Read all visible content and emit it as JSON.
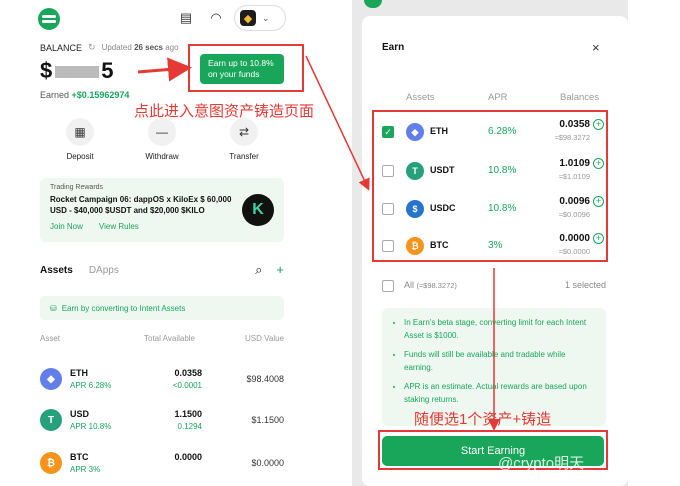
{
  "wallet": {
    "balance_label": "BALANCE",
    "updated_prefix": "Updated",
    "updated_value": "26 secs",
    "updated_suffix": "ago",
    "amount_prefix": "$",
    "amount_suffix": "5",
    "earned_label": "Earned",
    "earned_value": "+$0.15962974",
    "earn_button_line1": "Earn up to 10.8%",
    "earn_button_line2": "on your funds",
    "actions": [
      {
        "label": "Deposit",
        "icon": "qr-icon"
      },
      {
        "label": "Withdraw",
        "icon": "minus-icon"
      },
      {
        "label": "Transfer",
        "icon": "transfer-icon"
      }
    ],
    "promo": {
      "tag": "Trading Rewards",
      "title": "Rocket Campaign 06: dappOS x KiloEx $ 60,000 USD - $40,000 $USDT and $20,000 $KILO",
      "join": "Join Now",
      "rules": "View Rules",
      "logo_letter": "K"
    },
    "tabs": {
      "assets": "Assets",
      "dapps": "DApps"
    },
    "convert_text": "Earn by converting to Intent Assets",
    "columns": {
      "asset": "Asset",
      "total": "Total Available",
      "usd": "USD Value"
    },
    "assets": [
      {
        "name": "ETH",
        "apr": "APR 6.28%",
        "amount": "0.0358",
        "sub": "<0.0001",
        "usd": "$98.4008",
        "color": "#627eea",
        "glyph": "◆"
      },
      {
        "name": "USD",
        "apr": "APR 10.8%",
        "amount": "1.1500",
        "sub": "0.1294",
        "usd": "$1.1500",
        "color": "#26a17b",
        "glyph": "T"
      },
      {
        "name": "BTC",
        "apr": "APR 3%",
        "amount": "0.0000",
        "sub": "",
        "usd": "$0.0000",
        "color": "#f7931a",
        "glyph": "₿"
      }
    ]
  },
  "annotations": {
    "left": "点此进入意图资产铸造页面",
    "right": "随便选1个资产+铸造",
    "watermark": "@crypto明天"
  },
  "earn_modal": {
    "title": "Earn",
    "close": "×",
    "headers": {
      "assets": "Assets",
      "apr": "APR",
      "balances": "Balances"
    },
    "rows": [
      {
        "name": "ETH",
        "apr": "6.28%",
        "balance": "0.0358",
        "usd": "≈$98.3272",
        "checked": true,
        "color": "#627eea",
        "glyph": "◆"
      },
      {
        "name": "USDT",
        "apr": "10.8%",
        "balance": "1.0109",
        "usd": "≈$1.0109",
        "checked": false,
        "color": "#26a17b",
        "glyph": "T"
      },
      {
        "name": "USDC",
        "apr": "10.8%",
        "balance": "0.0096",
        "usd": "≈$0.0096",
        "checked": false,
        "color": "#2775ca",
        "glyph": "$"
      },
      {
        "name": "BTC",
        "apr": "3%",
        "balance": "0.0000",
        "usd": "≈$0.0000",
        "checked": false,
        "color": "#f7931a",
        "glyph": "₿"
      }
    ],
    "all_label": "All",
    "all_value": "(≈$98.3272)",
    "selected": "1 selected",
    "notes": [
      "In Earn's beta stage, converting limit for each Intent Asset is $1000.",
      "Funds will still be available and tradable while earning.",
      "APR is an estimate. Actual rewards are based upon staking returns."
    ],
    "start_button": "Start Earning"
  },
  "colors": {
    "brand_green": "#19a65a",
    "annotation_red": "#e53935"
  }
}
